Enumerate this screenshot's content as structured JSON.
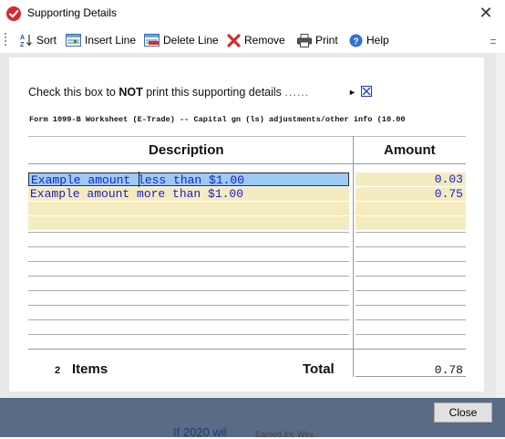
{
  "window": {
    "title": "Supporting Details",
    "close_glyph": "✕"
  },
  "toolbar": {
    "items": [
      {
        "label": "Sort",
        "icon": "sort-az-icon"
      },
      {
        "label": "Insert Line",
        "icon": "insert-line-icon"
      },
      {
        "label": "Delete Line",
        "icon": "delete-line-icon"
      },
      {
        "label": "Remove",
        "icon": "remove-x-icon"
      },
      {
        "label": "Print",
        "icon": "printer-icon"
      },
      {
        "label": "Help",
        "icon": "help-icon"
      }
    ]
  },
  "checkbox": {
    "text_before": "Check this box to ",
    "text_bold": "NOT",
    "text_after": " print this supporting details",
    "dots": "......",
    "arrow": "►",
    "checked": true
  },
  "form_title": "Form 1099-B Worksheet (E-Trade) -- Capital gn (ls) adjustments/other info (10.00",
  "table": {
    "headers": {
      "description": "Description",
      "amount": "Amount"
    },
    "rows": [
      {
        "description": "Example amount less than $1.00",
        "amount": "0.03"
      },
      {
        "description": "Example amount more than $1.00",
        "amount": "0.75"
      }
    ]
  },
  "footer": {
    "count": "2",
    "items_label": "Items",
    "total_label": "Total",
    "total_value": "0.78"
  },
  "buttons": {
    "close": "Close"
  },
  "background": {
    "fragment1": "If 2020 wil",
    "fragment2": "Earned Inc Wks"
  },
  "colors": {
    "accent_red": "#d9262b",
    "field_blue": "#1a1ad6",
    "row_yellow": "#f4ecc0",
    "selection_blue": "#9ccbf4"
  }
}
